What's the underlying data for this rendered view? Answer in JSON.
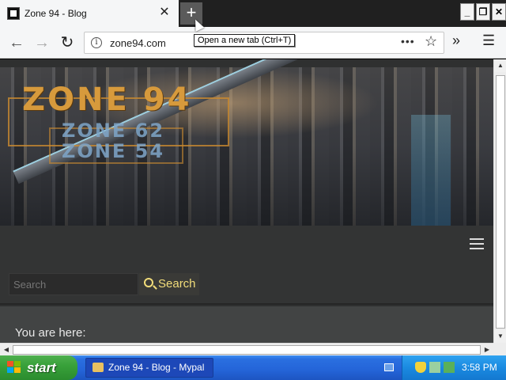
{
  "browser": {
    "tab_title": "Zone 94 - Blog",
    "tab_close_glyph": "✕",
    "newtab_glyph": "+",
    "tooltip": "Open a new tab (Ctrl+T)",
    "url": "zone94.com",
    "back_glyph": "←",
    "forward_glyph": "→",
    "reload_glyph": "↻",
    "page_actions_glyph": "•••",
    "bookmark_glyph": "☆",
    "overflow_glyph": "»",
    "menu_glyph": "☰",
    "window_buttons": [
      "_",
      "❐",
      "✕"
    ]
  },
  "site": {
    "logo_main": "ZONE 94",
    "logo_sub1": "ZONE 62",
    "logo_sub2": "ZONE 54",
    "search": {
      "placeholder": "Search",
      "button_label": "Search"
    },
    "breadcrumb_label": "You are here:"
  },
  "scrollbars": {
    "up": "▲",
    "down": "▼",
    "left": "◀",
    "right": "▶"
  },
  "taskbar": {
    "start_label": "start",
    "task_item": "Zone 94 - Blog - Mypal",
    "clock": "3:58 PM"
  },
  "icons": {
    "favicon": "zone94-favicon-icon",
    "info": "info-icon",
    "search": "magnifier-icon",
    "hamburger": "hamburger-icon"
  },
  "colors": {
    "search_accent": "#f2dd7a",
    "logo_orange": "#d79a3c",
    "taskbar_blue": "#2464d8",
    "start_green": "#38a13a"
  }
}
